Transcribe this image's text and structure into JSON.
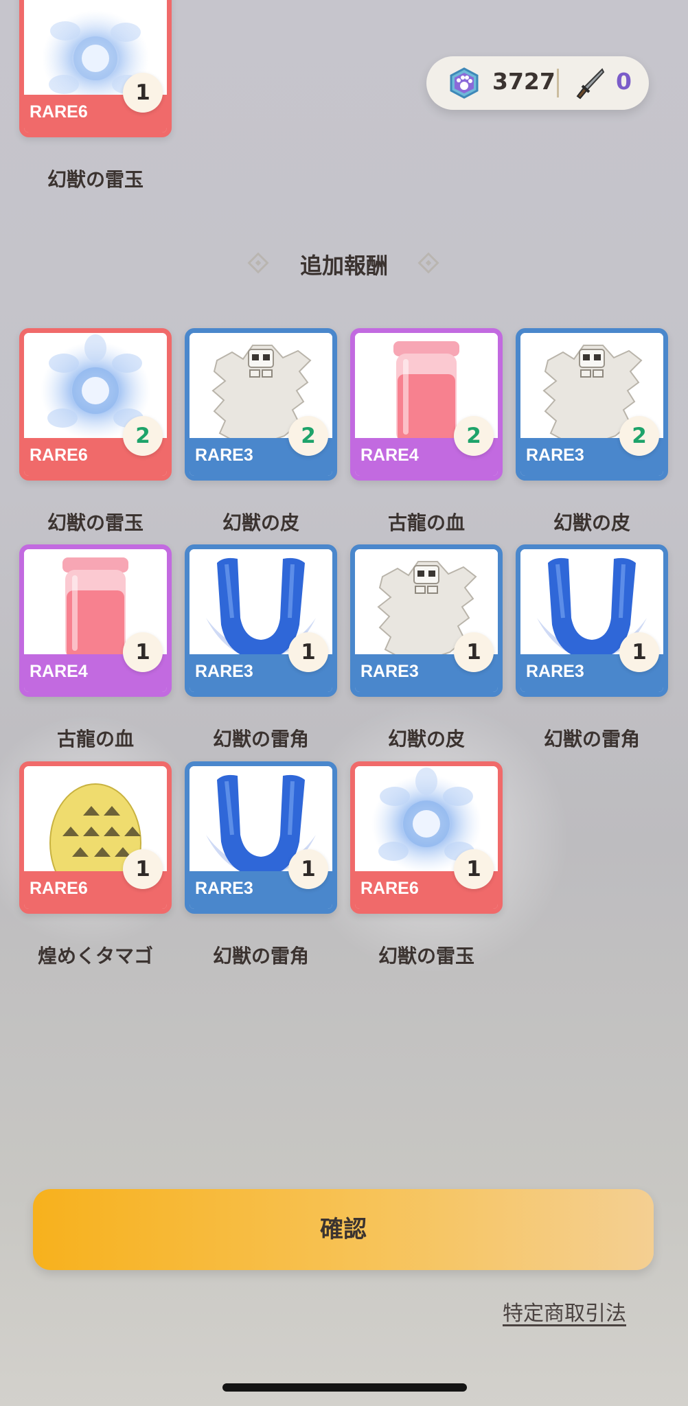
{
  "currency": {
    "gem_icon": "paw-gem-icon",
    "gem_value": "3727",
    "knife_icon": "knife-icon",
    "knife_value": "0"
  },
  "top_item": {
    "rarity": "RARE6",
    "count": "1",
    "name": "幻獣の雷玉",
    "icon": "thunder-orb-icon",
    "color": "#f06a6a"
  },
  "section_title": "追加報酬",
  "rewards": [
    {
      "rarity": "RARE6",
      "count": "2",
      "name": "幻獣の雷玉",
      "icon": "thunder-orb-icon"
    },
    {
      "rarity": "RARE3",
      "count": "2",
      "name": "幻獣の皮",
      "icon": "beast-hide-icon"
    },
    {
      "rarity": "RARE4",
      "count": "2",
      "name": "古龍の血",
      "icon": "blood-jar-icon"
    },
    {
      "rarity": "RARE3",
      "count": "2",
      "name": "幻獣の皮",
      "icon": "beast-hide-icon"
    },
    {
      "rarity": "RARE4",
      "count": "1",
      "name": "古龍の血",
      "icon": "blood-jar-icon"
    },
    {
      "rarity": "RARE3",
      "count": "1",
      "name": "幻獣の雷角",
      "icon": "thunder-horn-icon"
    },
    {
      "rarity": "RARE3",
      "count": "1",
      "name": "幻獣の皮",
      "icon": "beast-hide-icon"
    },
    {
      "rarity": "RARE3",
      "count": "1",
      "name": "幻獣の雷角",
      "icon": "thunder-horn-icon"
    },
    {
      "rarity": "RARE6",
      "count": "1",
      "name": "煌めくタマゴ",
      "icon": "shiny-egg-icon"
    },
    {
      "rarity": "RARE3",
      "count": "1",
      "name": "幻獣の雷角",
      "icon": "thunder-horn-icon"
    },
    {
      "rarity": "RARE6",
      "count": "1",
      "name": "幻獣の雷玉",
      "icon": "thunder-orb-icon"
    }
  ],
  "rarity_colors": {
    "RARE3": "#4a87cc",
    "RARE4": "#c26ae0",
    "RARE6": "#f06a6a"
  },
  "count_colors": {
    "multi": "#1ea36a",
    "single": "#2f2a28"
  },
  "confirm_label": "確認",
  "law_link": "特定商取引法"
}
